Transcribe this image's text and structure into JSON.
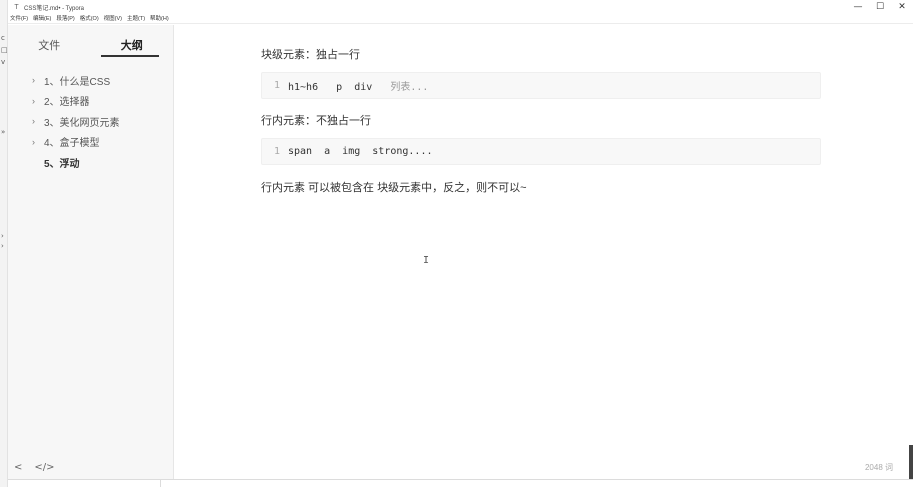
{
  "window": {
    "title": "CSS笔记.md• - Typora",
    "minimize": "—",
    "maximize": "☐",
    "close": "✕"
  },
  "menu": [
    "文件(F)",
    "编辑(E)",
    "段落(P)",
    "格式(O)",
    "视图(V)",
    "主题(T)",
    "帮助(H)"
  ],
  "sidebar": {
    "tabs": [
      {
        "label": "文件",
        "active": false
      },
      {
        "label": "大纲",
        "active": true
      }
    ],
    "outline": [
      {
        "label": "1、什么是CSS",
        "active": false
      },
      {
        "label": "2、选择器",
        "active": false
      },
      {
        "label": "3、美化网页元素",
        "active": false
      },
      {
        "label": "4、盒子模型",
        "active": false
      },
      {
        "label": "5、浮动",
        "active": true
      }
    ],
    "footer": {
      "back": "<",
      "source": "</>"
    }
  },
  "editor": {
    "p1": "块级元素：独占一行",
    "code1": {
      "line": "1",
      "code": "h1~h6   p  div   ",
      "muted": "列表..."
    },
    "p2": "行内元素：不独占一行",
    "code2": {
      "line": "1",
      "code": "span  a  img  strong...."
    },
    "p3": "行内元素 可以被包含在 块级元素中，反之，则不可以~",
    "cursor": "I"
  },
  "status": {
    "word_count": "2048 词"
  }
}
